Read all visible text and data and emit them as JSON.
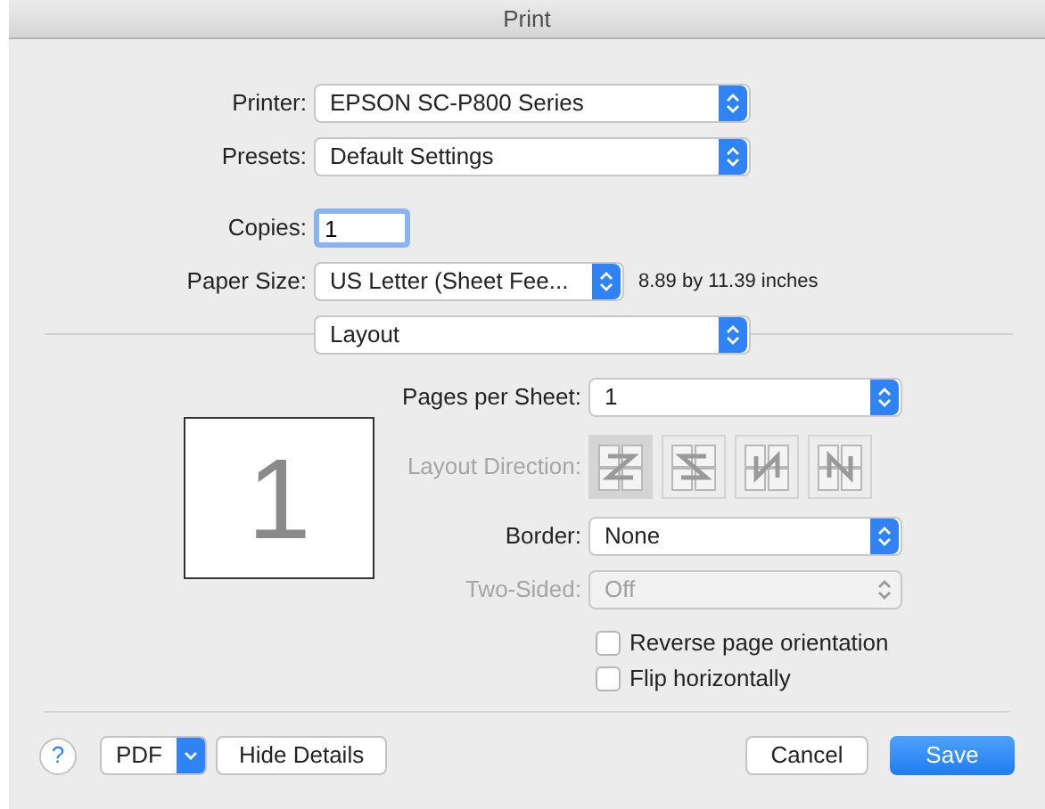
{
  "window": {
    "title": "Print"
  },
  "fields": [
    {
      "kind": "popup",
      "label": "Printer:",
      "value": "EPSON SC-P800 Series"
    },
    {
      "kind": "popup",
      "label": "Presets:",
      "value": "Default Settings"
    },
    {
      "kind": "text",
      "label": "Copies:",
      "value": "1"
    },
    {
      "kind": "popup",
      "label": "Paper Size:",
      "value": "US Letter (Sheet Fee...",
      "note": "8.89 by 11.39 inches"
    }
  ],
  "section_popup": {
    "value": "Layout"
  },
  "preview": {
    "page_number": "1"
  },
  "layout_options": [
    {
      "kind": "popup",
      "label": "Pages per Sheet:",
      "value": "1",
      "disabled": false
    },
    {
      "kind": "direction",
      "label": "Layout Direction:",
      "disabled": true,
      "directions": [
        {
          "kind": "z",
          "selected": true
        },
        {
          "kind": "s",
          "selected": false
        },
        {
          "kind": "rn",
          "selected": false
        },
        {
          "kind": "n",
          "selected": false
        }
      ]
    },
    {
      "kind": "popup",
      "label": "Border:",
      "value": "None",
      "disabled": false
    },
    {
      "kind": "popup",
      "label": "Two-Sided:",
      "value": "Off",
      "disabled": true
    },
    {
      "kind": "checkbox",
      "label": "Reverse page orientation",
      "checked": false
    },
    {
      "kind": "checkbox",
      "label": "Flip horizontally",
      "checked": false
    }
  ],
  "footer": {
    "help": "?",
    "pdf": "PDF",
    "details_button": "Hide Details",
    "cancel_button": "Cancel",
    "save_button": "Save"
  }
}
